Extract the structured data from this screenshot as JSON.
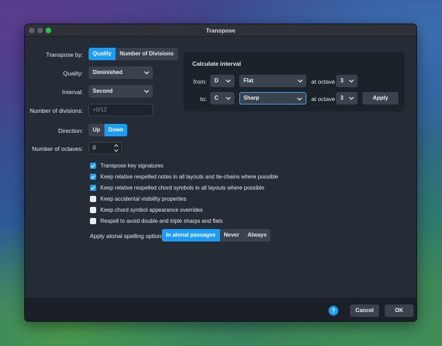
{
  "window": {
    "title": "Transpose"
  },
  "transpose_by": {
    "label": "Transpose by:",
    "options": [
      "Quality",
      "Number of Divisions"
    ],
    "selected": "Quality"
  },
  "quality": {
    "label": "Quality:",
    "value": "Diminished"
  },
  "interval": {
    "label": "Interval:",
    "value": "Second"
  },
  "divisions": {
    "label": "Number of divisions:",
    "placeholder": "+0/12"
  },
  "direction": {
    "label": "Direction:",
    "options": [
      "Up",
      "Down"
    ],
    "selected": "Down"
  },
  "octaves": {
    "label": "Number of octaves:",
    "value": "0"
  },
  "calculate": {
    "title": "Calculate interval",
    "from_label": "from:",
    "to_label": "to:",
    "from_note": "D",
    "from_accidental": "Flat",
    "from_octave": "3",
    "to_note": "C",
    "to_accidental": "Sharp",
    "to_octave": "3",
    "at_octave_label": "at octave",
    "apply_label": "Apply"
  },
  "checkboxes": [
    {
      "label": "Transpose key signatures",
      "checked": true
    },
    {
      "label": "Keep relative respelled notes in all layouts and tie-chains where possible",
      "checked": true
    },
    {
      "label": "Keep relative respelled chord symbols in all layouts where possible",
      "checked": true
    },
    {
      "label": "Keep accidental visibility properties",
      "checked": false
    },
    {
      "label": "Keep chord symbol appearance overrides",
      "checked": false
    },
    {
      "label": "Respell to avoid double and triple sharps and flats",
      "checked": false
    }
  ],
  "atonal": {
    "label": "Apply atonal spelling options:",
    "options": [
      "In atonal passages",
      "Never",
      "Always"
    ],
    "selected": "In atonal passages"
  },
  "footer": {
    "help_label": "?",
    "cancel_label": "Cancel",
    "ok_label": "OK"
  },
  "colors": {
    "accent": "#1c9cf3",
    "window_bg": "#252c36",
    "panel_bg": "#1c2229",
    "control_bg": "#3a424d"
  }
}
